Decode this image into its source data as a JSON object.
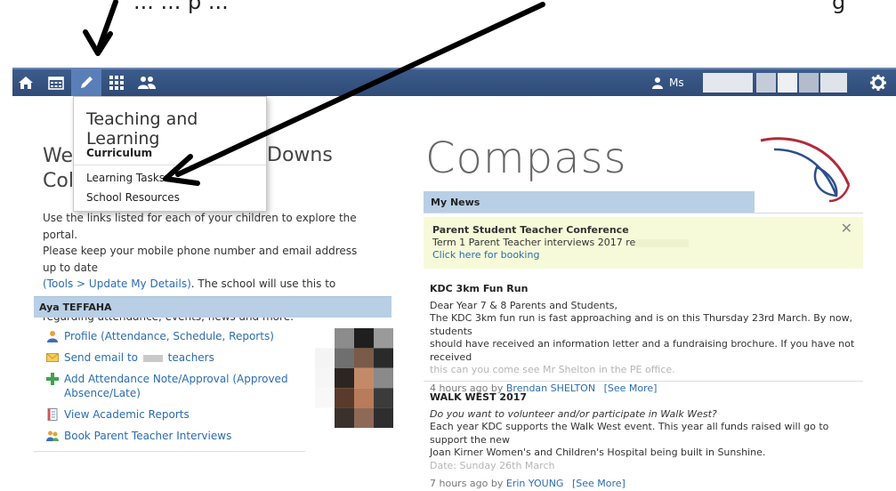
{
  "overlay": {
    "partial_text_left": "... ... p ...",
    "partial_text_right": "g"
  },
  "navbar": {
    "items": [
      {
        "name": "home-icon"
      },
      {
        "name": "calendar-icon"
      },
      {
        "name": "pencil-icon"
      },
      {
        "name": "grid-icon"
      },
      {
        "name": "people-icon"
      }
    ],
    "user_label": "Ms",
    "settings_icon": "gear-icon"
  },
  "dropdown": {
    "title": "Teaching and Learning",
    "section": "Curriculum",
    "items": [
      "Learning Tasks",
      "School Resources"
    ]
  },
  "welcome": {
    "heading_line1": "We",
    "heading_line2": "Col",
    "heading_right": "Downs",
    "intro_line1": "Use the links listed for each of your children to explore the portal.",
    "intro_line2": "Please keep your mobile phone number and email address up to date",
    "intro_link": "(Tools > Update My Details)",
    "intro_line3_rest": ". The school will use this to contact you",
    "intro_line4": "regarding attendance, events, news and more."
  },
  "student": {
    "name": "Aya TEFFAHA",
    "links": [
      {
        "icon": "person-icon",
        "text": "Profile (Attendance, Schedule, Reports)"
      },
      {
        "icon": "envelope-icon",
        "text_before": "Send email to",
        "text_after": "teachers"
      },
      {
        "icon": "plus-icon",
        "text": "Add Attendance Note/Approval (Approved Absence/Late)"
      },
      {
        "icon": "report-icon",
        "text": "View Academic Reports"
      },
      {
        "icon": "group-icon",
        "text": "Book Parent Teacher Interviews"
      }
    ]
  },
  "compass": {
    "title": "Compass",
    "news_header": "My News",
    "alert": {
      "title": "Parent Student Teacher Conference",
      "body": "Term 1 Parent Teacher interviews 2017 re",
      "link": "Click here for booking"
    },
    "news": [
      {
        "title": "KDC 3km Fun Run",
        "lines": [
          "Dear Year 7 & 8 Parents and Students,",
          "The KDC 3km fun run is fast approaching and is on this Thursday 23rd March. By now, students",
          "should have received an information letter and a fundraising brochure. If you have not received",
          "this can you come see Mr Shelton in the PE office."
        ],
        "time": "4 hours ago by",
        "author": "Brendan SHELTON",
        "see_more": "[See More]"
      },
      {
        "title": "WALK WEST 2017",
        "subtitle": "Do you want to volunteer and/or participate in Walk West?",
        "lines": [
          "Each year KDC supports the Walk West event. This year all funds raised will go to support the new",
          "Joan Kirner Women's and Children's Hospital being built in Sunshine.",
          "Date: Sunday 26th March"
        ],
        "time": "7 hours ago by",
        "author": "Erin YOUNG",
        "see_more": "[See More]"
      }
    ]
  },
  "colors": {
    "navbar": "#2f4b77",
    "active_tab": "#5a7fb8",
    "section_bar": "#b8cfe6",
    "alert_bg": "#f6fad8",
    "link": "#2b6cb0",
    "logo_red": "#b3283a",
    "logo_blue": "#2c4f8c"
  }
}
